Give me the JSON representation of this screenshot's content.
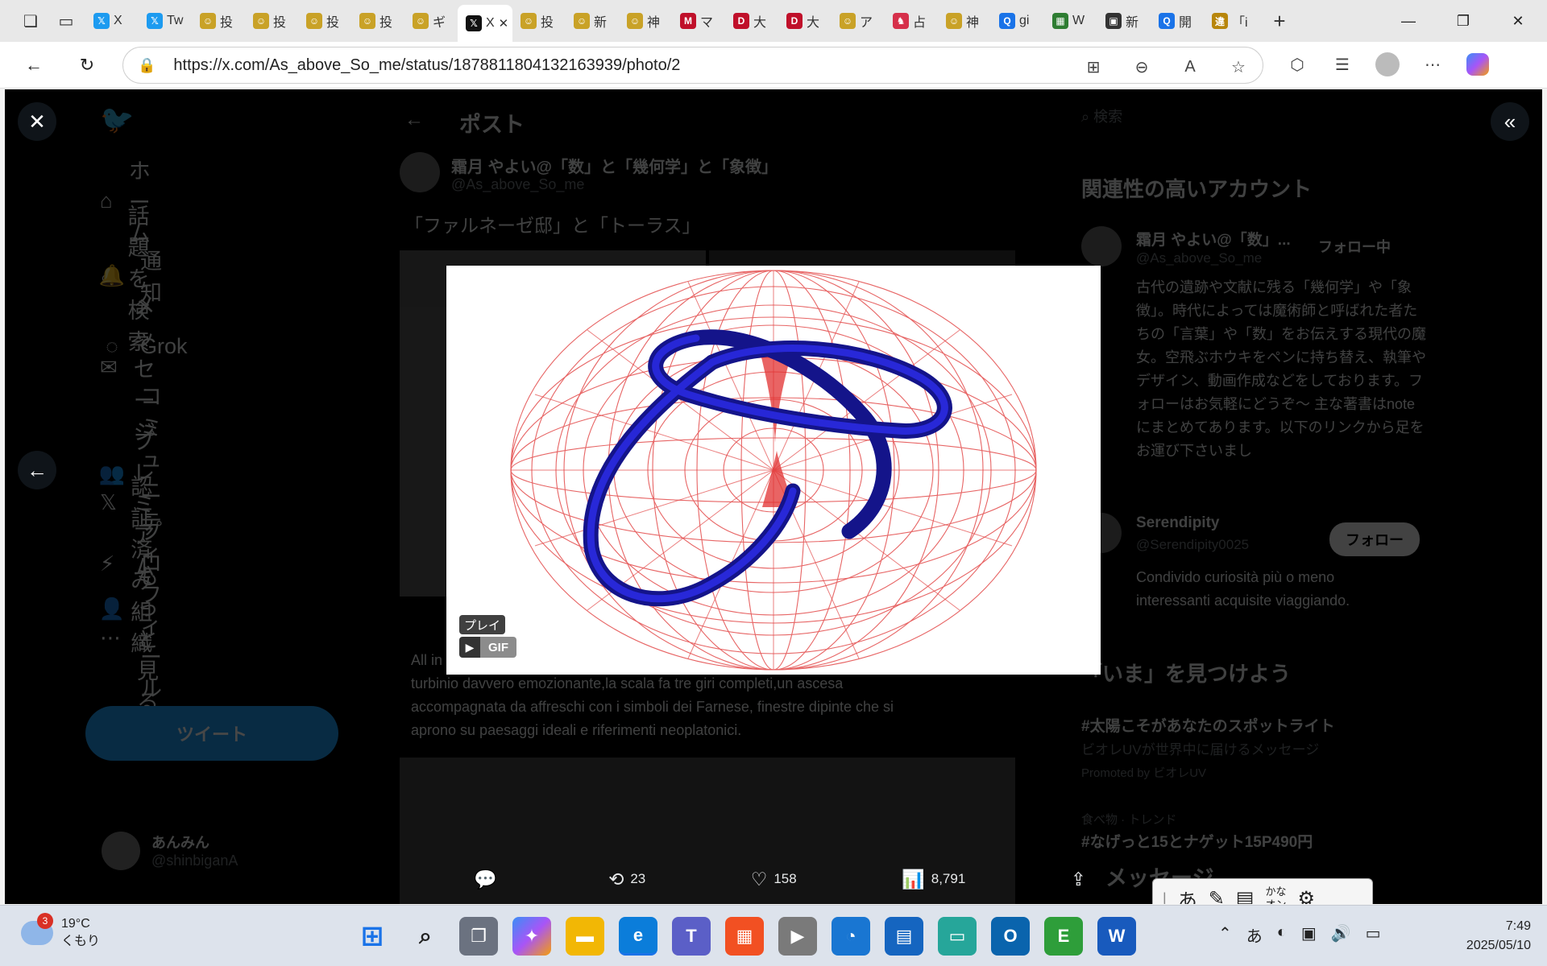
{
  "tabs": [
    {
      "label": "X",
      "fav": "#1d9bf0",
      "glyph": "𝕏"
    },
    {
      "label": "Tw",
      "fav": "#1d9bf0",
      "glyph": "𝕏"
    },
    {
      "label": "投",
      "fav": "#c9a227",
      "glyph": "☺"
    },
    {
      "label": "投",
      "fav": "#c9a227",
      "glyph": "☺"
    },
    {
      "label": "投",
      "fav": "#c9a227",
      "glyph": "☺"
    },
    {
      "label": "投",
      "fav": "#c9a227",
      "glyph": "☺"
    },
    {
      "label": "ギ",
      "fav": "#c9a227",
      "glyph": "☺"
    },
    {
      "label": "X",
      "fav": "#111",
      "glyph": "𝕏"
    },
    {
      "label": "投",
      "fav": "#c9a227",
      "glyph": "☺"
    },
    {
      "label": "新",
      "fav": "#c9a227",
      "glyph": "☺"
    },
    {
      "label": "神",
      "fav": "#c9a227",
      "glyph": "☺"
    },
    {
      "label": "マ",
      "fav": "#c0102a",
      "glyph": "M"
    },
    {
      "label": "大",
      "fav": "#c0102a",
      "glyph": "D"
    },
    {
      "label": "大",
      "fav": "#c0102a",
      "glyph": "D"
    },
    {
      "label": "ア",
      "fav": "#c9a227",
      "glyph": "☺"
    },
    {
      "label": "占",
      "fav": "#d6304a",
      "glyph": "♞"
    },
    {
      "label": "神",
      "fav": "#c9a227",
      "glyph": "☺"
    },
    {
      "label": "gi",
      "fav": "#1a73e8",
      "glyph": "Q"
    },
    {
      "label": "W",
      "fav": "#2e7d32",
      "glyph": "▦"
    },
    {
      "label": "新",
      "fav": "#333",
      "glyph": "▣"
    },
    {
      "label": "開",
      "fav": "#1a73e8",
      "glyph": "Q"
    },
    {
      "label": "「i",
      "fav": "#b8860b",
      "glyph": "違"
    }
  ],
  "url": "https://x.com/As_above_So_me/status/1878811804132163939/photo/2",
  "sidebar": [
    {
      "icon": "home-icon",
      "glyph": "⌂",
      "label": "ホーム"
    },
    {
      "icon": "search-icon",
      "glyph": "⌕",
      "label": "話題を検索"
    },
    {
      "icon": "bell-icon",
      "glyph": "🔔",
      "label": "通知"
    },
    {
      "icon": "mail-icon",
      "glyph": "✉",
      "label": "メッセージ"
    },
    {
      "icon": "grok-icon",
      "glyph": "◌",
      "label": "Grok"
    },
    {
      "icon": "community-icon",
      "glyph": "👥",
      "label": "コミュニティ"
    },
    {
      "icon": "x-premium-icon",
      "glyph": "𝕏",
      "label": "プレミアム"
    },
    {
      "icon": "lightning-icon",
      "glyph": "⚡",
      "label": "認証済み組織"
    },
    {
      "icon": "profile-icon",
      "glyph": "👤",
      "label": "プロフィール"
    },
    {
      "icon": "more-icon",
      "glyph": "⋯",
      "label": "もっと見る"
    }
  ],
  "tweet_button": "ツイート",
  "account": {
    "name": "あんみん",
    "handle": "@shinbiganA"
  },
  "post": {
    "header": "ポスト",
    "author": "霜月 やよい@「数」と「幾何学」と「象徴」",
    "handle": "@As_above_So_me",
    "text": "「ファルネーゼ邸」と「トーラス」",
    "quote_line1": "All in",
    "quote_line2": "turbinio davvero emozionante,la scala fa tre giri completi,un ascesa",
    "quote_line3": "accompagnata da affreschi con i simboli dei Farnese, finestre dipinte che si",
    "quote_line4": "aprono su paesaggi ideali e riferimenti neoplatonici."
  },
  "right": {
    "search": "検索",
    "related_title": "関連性の高いアカウント",
    "acct1_name": "霜月 やよい@「数」...",
    "acct1_handle": "@As_above_So_me",
    "acct1_follow": "フォロー中",
    "acct1_bio": "古代の遺跡や文献に残る「幾何学」や「象徴」。時代によっては魔術師と呼ばれた者たちの「言葉」や「数」をお伝えする現代の魔女。空飛ぶホウキをペンに持ち替え、執筆やデザイン、動画作成などをしております。フォローはお気軽にどうぞ〜 主な著書はnoteにまとめてあります。以下のリンクから足をお運び下さいまし",
    "acct2_name": "Serendipity",
    "acct2_handle": "@Serendipity0025",
    "acct2_follow": "フォロー",
    "acct2_bio": "Condivido curiosità più o meno interessanti acquisite viaggiando.",
    "now_title": "「いま」を見つけよう",
    "trend1": "#太陽こそがあなたのスポットライト",
    "trend1_sub": "ビオレUVが世界中に届けるメッセージ",
    "trend1_promo": "Promoted by ビオレUV",
    "trend2_cat": "食べ物 · トレンド",
    "trend2": "#なげっと15とナゲット15P490円",
    "msg_title": "メッセージ"
  },
  "media": {
    "play_label": "プレイ",
    "gif_label": "GIF"
  },
  "actions": {
    "reply": "",
    "retweet": "23",
    "like": "158",
    "views": "8,791"
  },
  "ime": {
    "a": "あ",
    "kana_top": "かな",
    "kana_bottom": "オン"
  },
  "weather": {
    "temp": "19°C",
    "cond": "くもり",
    "badge": "3"
  },
  "clock": {
    "time": "7:49",
    "date": "2025/05/10"
  },
  "tray_ime": "あ"
}
